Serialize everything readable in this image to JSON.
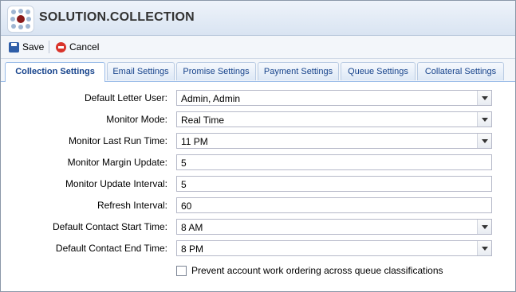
{
  "app": {
    "title": "SOLUTION.COLLECTION"
  },
  "toolbar": {
    "save_label": "Save",
    "cancel_label": "Cancel"
  },
  "tabs": [
    {
      "label": "Collection Settings",
      "active": true
    },
    {
      "label": "Email Settings"
    },
    {
      "label": "Promise Settings"
    },
    {
      "label": "Payment Settings"
    },
    {
      "label": "Queue Settings"
    },
    {
      "label": "Collateral Settings"
    }
  ],
  "form": {
    "default_letter_user": {
      "label": "Default Letter User:",
      "value": "Admin, Admin"
    },
    "monitor_mode": {
      "label": "Monitor Mode:",
      "value": "Real Time"
    },
    "monitor_last_run_time": {
      "label": "Monitor Last Run Time:",
      "value": "11 PM"
    },
    "monitor_margin_update": {
      "label": "Monitor Margin Update:",
      "value": "5"
    },
    "monitor_update_interval": {
      "label": "Monitor Update Interval:",
      "value": "5"
    },
    "refresh_interval": {
      "label": "Refresh Interval:",
      "value": "60"
    },
    "default_contact_start_time": {
      "label": "Default Contact Start Time:",
      "value": "8 AM"
    },
    "default_contact_end_time": {
      "label": "Default Contact End Time:",
      "value": "8 PM"
    },
    "prevent_ordering": {
      "label": "Prevent account work ordering across queue classifications",
      "checked": false
    }
  }
}
